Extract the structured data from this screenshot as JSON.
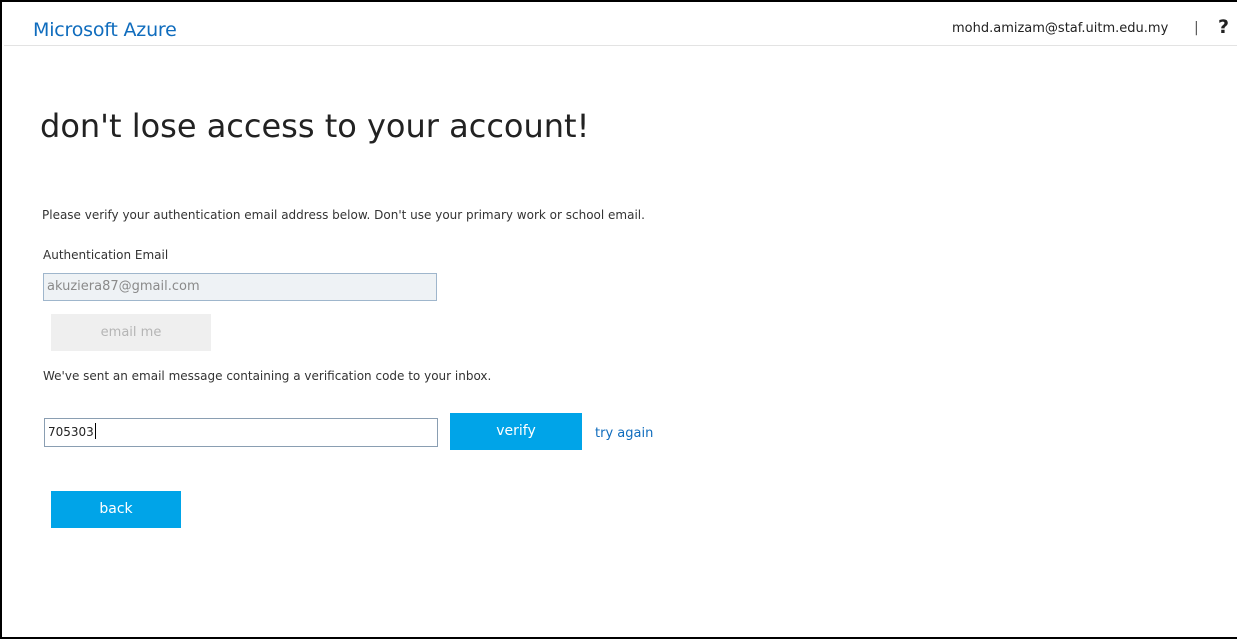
{
  "header": {
    "brand": "Microsoft Azure",
    "user_email": "mohd.amizam@staf.uitm.edu.my",
    "separator": "|",
    "help_label": "?"
  },
  "main": {
    "title": "don't lose access to your account!",
    "instruction": "Please verify your authentication email address below. Don't use your primary work or school email.",
    "email_label": "Authentication Email",
    "email_value": "akuziera87@gmail.com",
    "email_button": "email me",
    "sent_message": "We've sent an email message containing a verification code to your inbox.",
    "code_value": "705303",
    "verify_button": "verify",
    "try_again_link": "try again",
    "back_button": "back"
  },
  "colors": {
    "brand": "#0f6cbd",
    "primary_button": "#00a4e8",
    "disabled_button": "#efefef",
    "link": "#0f6cbd"
  },
  "icons": {
    "help": "question-mark-icon"
  }
}
